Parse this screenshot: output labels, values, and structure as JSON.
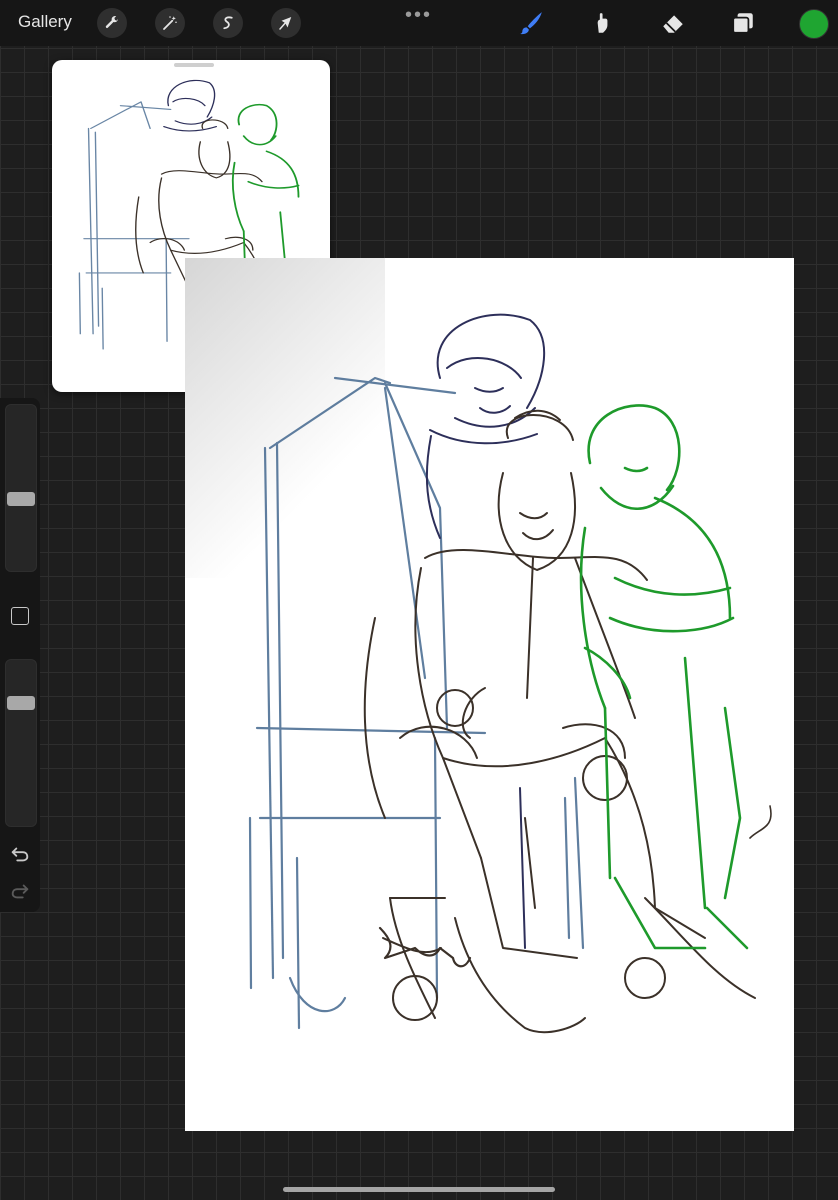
{
  "topbar": {
    "gallery_label": "Gallery",
    "left_tools": [
      "wrench-icon",
      "magic-wand-icon",
      "selection-icon",
      "transform-arrow-icon"
    ],
    "more_label": "•••",
    "right_tools": [
      "brush-icon",
      "smudge-icon",
      "eraser-icon",
      "layers-icon"
    ],
    "active_tool": "brush-icon",
    "accent_color": "#3f7df5",
    "current_color": "#1fa531"
  },
  "sidebar": {
    "brush_size_level": 0.43,
    "opacity_level": 0.24,
    "items": [
      "brush-size-slider",
      "modify-button",
      "opacity-slider",
      "undo-icon",
      "redo-icon"
    ]
  },
  "reference": {
    "label": ""
  },
  "canvas": {
    "sketch_colors": {
      "throne": "#44688f",
      "center_figure": "#3b3129",
      "back_figure": "#2d2f5a",
      "right_figure": "#1e9a2b"
    }
  }
}
